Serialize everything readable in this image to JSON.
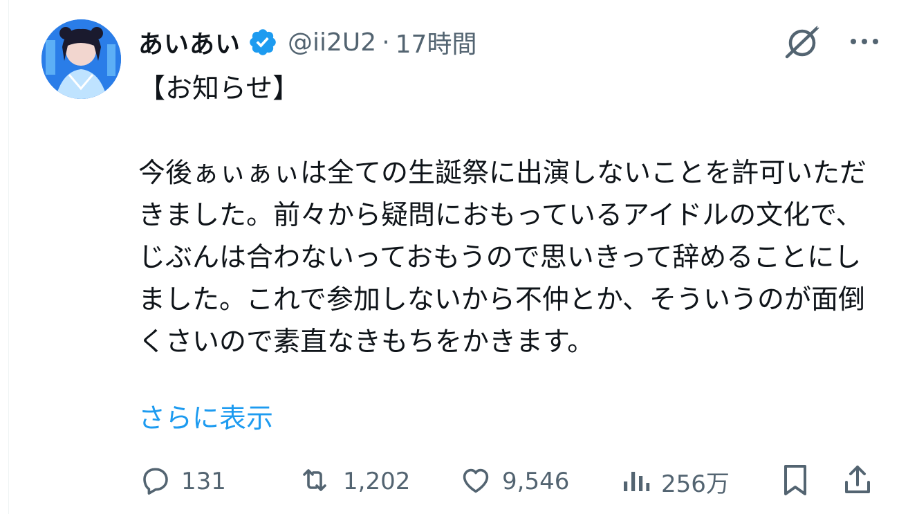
{
  "tweet": {
    "author": {
      "display_name": "あいあい",
      "handle": "@ii2U2",
      "verified": true
    },
    "separator": "·",
    "time": "17時間",
    "body": "【お知らせ】\n\n今後ぁぃぁぃは全ての生誕祭に出演しないことを許可いただきました。前々から疑問におもっているアイドルの文化で、じぶんは合わないっておもうので思いきって辞めることにしました。これで参加しないから不仲とか、そういうのが面倒くさいので素直なきもちをかきます。",
    "show_more": "さらに表示",
    "metrics": {
      "replies": "131",
      "retweets": "1,202",
      "likes": "9,546",
      "views": "256万"
    }
  },
  "icons": {
    "verified": "verified-badge-icon",
    "grok": "grok-icon",
    "more": "more-icon",
    "reply": "reply-icon",
    "retweet": "retweet-icon",
    "like": "heart-icon",
    "views": "views-icon",
    "bookmark": "bookmark-icon",
    "share": "share-icon"
  },
  "colors": {
    "text_primary": "#0f1419",
    "text_secondary": "#536471",
    "link": "#1d9bf0",
    "verified": "#1d9bf0"
  }
}
